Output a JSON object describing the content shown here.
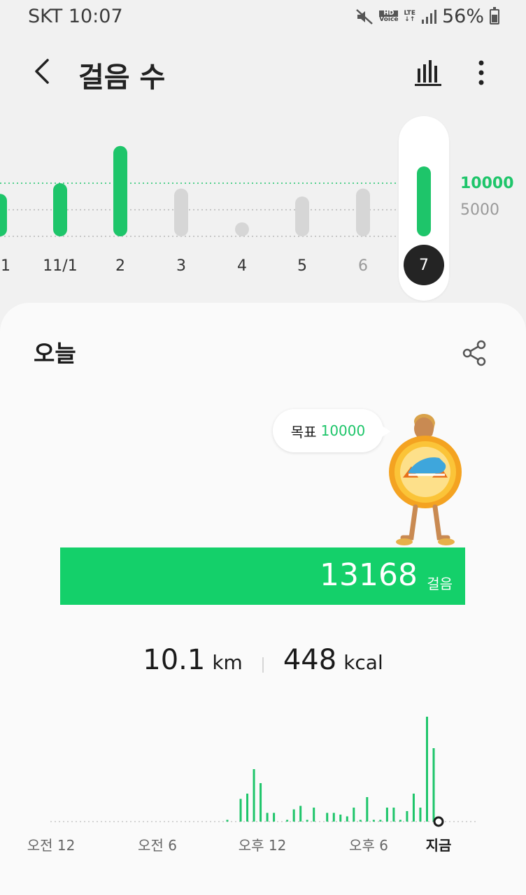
{
  "status": {
    "carrier_time": "SKT 10:07",
    "hd_label": "HD",
    "voice_label": "Voice",
    "lte_label": "LTE",
    "battery": "56%",
    "battery_level": 0.56
  },
  "header": {
    "title": "걸음 수",
    "back_icon": "chevron-left-icon",
    "chart_icon": "bar-chart-icon",
    "more_icon": "more-vertical-icon"
  },
  "week_chart": {
    "goal_label": "10000",
    "half_label": "5000",
    "selected_day": "7",
    "days": [
      {
        "label": "1",
        "value": 8000,
        "dim": false
      },
      {
        "label": "11/1",
        "value": 10000,
        "dim": false
      },
      {
        "label": "2",
        "value": 17000,
        "dim": false
      },
      {
        "label": "3",
        "value": 9000,
        "dim": true
      },
      {
        "label": "4",
        "value": 0,
        "dim": true
      },
      {
        "label": "5",
        "value": 7500,
        "dim": true
      },
      {
        "label": "6",
        "value": 9000,
        "dim": true
      },
      {
        "label": "7",
        "value": 13168,
        "dim": false
      }
    ],
    "colors": {
      "active": "#1ec56a",
      "inactive": "#d6d6d6",
      "goal_line": "#1ec56a",
      "half_line": "#b8b8b8"
    }
  },
  "today": {
    "title": "오늘",
    "share_icon": "share-icon",
    "goal_text": "목표",
    "goal_value": "10000",
    "steps_value": "13168",
    "steps_unit": "걸음",
    "steps_fill_color": "#14d06a",
    "distance_value": "10.1",
    "distance_unit": "km",
    "calories_value": "448",
    "calories_unit": "kcal"
  },
  "day_chart": {
    "time_labels": [
      "오전 12",
      "오전 6",
      "오후 12",
      "오후 6",
      "지금"
    ],
    "bar_color": "#1ec56a",
    "bars": [
      1,
      0,
      13,
      16,
      30,
      22,
      5,
      5,
      0,
      1,
      7,
      9,
      1,
      8,
      0,
      5,
      5,
      4,
      3,
      8,
      1,
      14,
      1,
      1,
      8,
      8,
      1,
      6,
      16,
      8,
      60,
      42
    ]
  }
}
